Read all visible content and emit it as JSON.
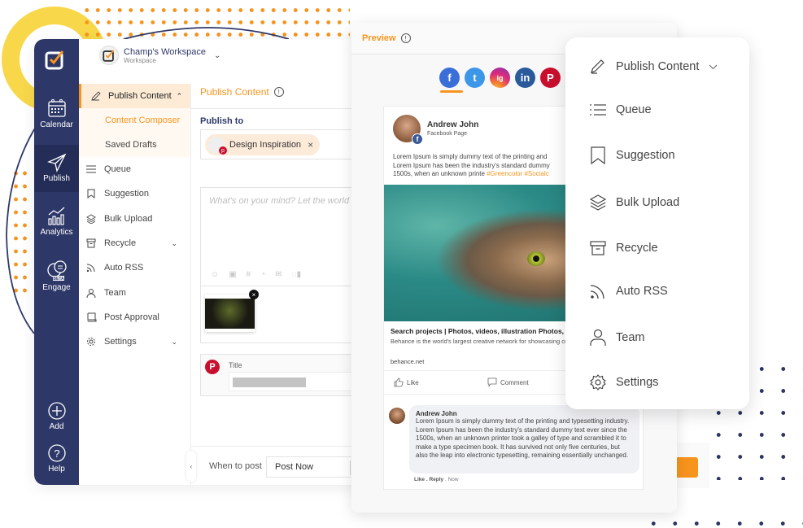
{
  "rail": {
    "items": [
      {
        "label": "Calendar",
        "icon": "calendar-icon"
      },
      {
        "label": "Publish",
        "icon": "paper-plane-icon",
        "active": true
      },
      {
        "label": "Analytics",
        "icon": "analytics-icon"
      },
      {
        "label": "Engage",
        "icon": "chat-bubbles-icon",
        "badge": "BETA"
      },
      {
        "label": "Add",
        "icon": "plus-circle-icon"
      },
      {
        "label": "Help",
        "icon": "help-circle-icon"
      }
    ]
  },
  "workspace": {
    "name": "Champ's Workspace",
    "subtitle": "Workspace"
  },
  "subnav": {
    "header": "Publish Content",
    "subitems": [
      "Content Composer",
      "Saved Drafts"
    ],
    "items": [
      "Queue",
      "Suggestion",
      "Bulk Upload",
      "Recycle",
      "Auto RSS",
      "Team",
      "Post Approval",
      "Settings"
    ]
  },
  "composer": {
    "title": "Publish Content",
    "info_icon": "!",
    "publish_to_label": "Publish to",
    "selected_account": "Design Inspiration",
    "editor_placeholder": "What's on your mind? Let the world",
    "pinterest_title_label": "Title",
    "when_to_post_label": "When to post",
    "when_to_post_value": "Post Now"
  },
  "preview": {
    "title": "Preview",
    "info_icon": "!",
    "networks": [
      "f",
      "t",
      "ig",
      "in",
      "P"
    ],
    "network_colors": [
      "#3b6fd8",
      "#3d97e8",
      "#d6336c",
      "#2a5a9c",
      "#c8102e"
    ],
    "post": {
      "author": "Andrew John",
      "page_type": "Facebook Page",
      "text_lines": [
        "Lorem Ipsum is simply dummy text of the printing and",
        "Lorem Ipsum has been the industry's standard dummy",
        "1500s, when an unknown printe "
      ],
      "hashtags": "#Greencolor #Socialc",
      "link_title": "Search projects | Photos, videos, illustration Photos,",
      "link_desc": "Behance is the world's largest creative network for showcasing creative work",
      "link_domain": "behance.net",
      "like_label": "Like",
      "comment_label": "Comment"
    },
    "comment": {
      "author": "Andrew John",
      "text": "Lorem Ipsum is simply dummy text of the printing and typesetting industry. Lorem Ipsum has been the industry's standard dummy text ever since the 1500s, when an unknown printer took a galley of type and scrambled it to make a type specimen book. It has survived not only five centuries, but also the leap into electronic typesetting, remaining essentially unchanged.",
      "like": "Like",
      "reply": "Reply",
      "time": "Now",
      "separator": " . "
    },
    "post_button_partial": "w"
  },
  "floating_menu": {
    "items": [
      {
        "label": "Publish Content",
        "icon": "pencil-icon"
      },
      {
        "label": "Queue",
        "icon": "list-icon"
      },
      {
        "label": "Suggestion",
        "icon": "bookmark-icon"
      },
      {
        "label": "Bulk Upload",
        "icon": "layers-icon"
      },
      {
        "label": "Recycle",
        "icon": "archive-icon"
      },
      {
        "label": "Auto RSS",
        "icon": "rss-icon"
      },
      {
        "label": "Team",
        "icon": "user-icon"
      },
      {
        "label": "Settings",
        "icon": "gear-icon"
      }
    ]
  },
  "colors": {
    "accent": "#f7941d",
    "navy": "#2e3868",
    "highlight": "#fdebd6"
  }
}
